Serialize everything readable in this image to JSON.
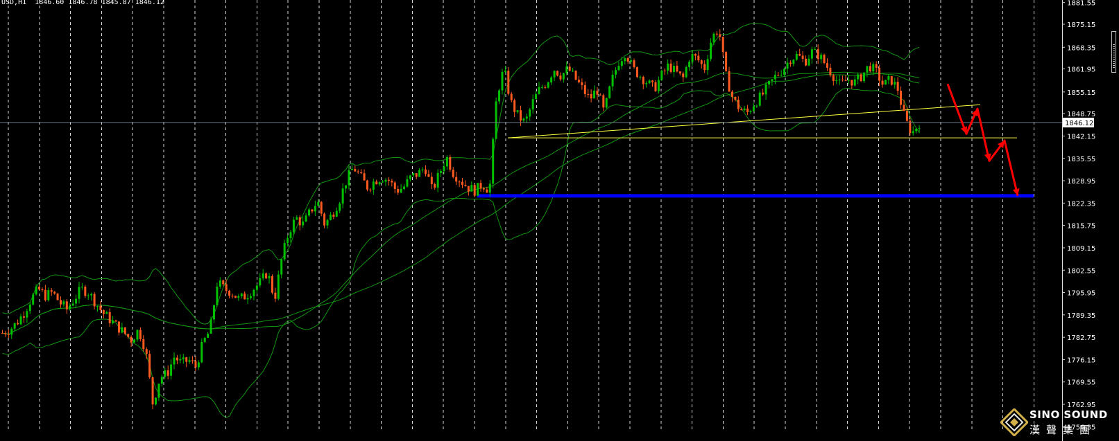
{
  "header": {
    "symbol": "USD,H1",
    "open": "1846.60",
    "high": "1846.78",
    "low": "1845.87",
    "close": "1846.12"
  },
  "logo": {
    "en": "SINO SOUND",
    "cn": "漢聲集團"
  },
  "chart_data": {
    "type": "candlestick",
    "price_axis": {
      "ticks": [
        "1881.55",
        "1875.15",
        "1868.35",
        "1861.95",
        "1855.15",
        "1848.75",
        "1842.15",
        "1835.55",
        "1828.95",
        "1822.35",
        "1815.75",
        "1809.15",
        "1802.55",
        "1795.95",
        "1789.35",
        "1782.75",
        "1776.15",
        "1769.55",
        "1762.95",
        "1756.35"
      ],
      "range": [
        1755.6,
        1882.3
      ],
      "current_price": "1846.12",
      "current_price_label": "1846.12"
    },
    "grid": {
      "vertical": true,
      "horizontal": false
    },
    "colors": {
      "bull": "#00c000",
      "bear": "#ff5a1f",
      "bands": "#139413",
      "support_line": "#0000ff",
      "trend_lines": "#ffff40",
      "forecast_arrow": "#ff0000",
      "axis_text": "#ffffff",
      "current_line": "#6e7b8b"
    },
    "annotations": [
      {
        "type": "horizontal_support",
        "price": 1824.5,
        "color": "#0000ff"
      },
      {
        "type": "horizontal_line",
        "price": 1841.6,
        "color": "#ffff40"
      },
      {
        "type": "ascending_trendline",
        "from_price": 1841.6,
        "to_price": 1851.4,
        "color": "#ffff40"
      },
      {
        "type": "forecast_zigzag",
        "prices": [
          1857.5,
          1842.8,
          1850.2,
          1834.8,
          1840.8,
          1824.5
        ],
        "color": "#ff0000"
      }
    ],
    "price_path": [
      1784,
      1785,
      1787,
      1790,
      1794,
      1797,
      1795,
      1796,
      1793,
      1791,
      1794,
      1797,
      1796,
      1793,
      1790,
      1788,
      1786,
      1784,
      1782,
      1785,
      1779,
      1763,
      1771,
      1772,
      1777,
      1775,
      1776,
      1774,
      1781,
      1785,
      1799,
      1797,
      1796,
      1794,
      1795,
      1797,
      1799,
      1802,
      1794,
      1806,
      1814,
      1818,
      1816,
      1820,
      1823,
      1816,
      1819,
      1823,
      1829,
      1833,
      1830,
      1827,
      1829,
      1830,
      1829,
      1826,
      1827,
      1830,
      1831,
      1833,
      1826,
      1831,
      1836,
      1831,
      1829,
      1827,
      1826,
      1828,
      1826,
      1854,
      1862,
      1852,
      1848,
      1846,
      1852,
      1856,
      1858,
      1862,
      1860,
      1862,
      1859,
      1856,
      1853,
      1856,
      1849,
      1858,
      1864,
      1867,
      1862,
      1860,
      1858,
      1856,
      1860,
      1863,
      1861,
      1859,
      1866,
      1865,
      1862,
      1871,
      1874,
      1860,
      1853,
      1850,
      1849,
      1852,
      1854,
      1857,
      1860,
      1862,
      1865,
      1866,
      1864,
      1867,
      1866,
      1863,
      1860,
      1857,
      1859,
      1858,
      1860,
      1863,
      1861,
      1857,
      1859,
      1856,
      1847,
      1843,
      1846
    ]
  }
}
